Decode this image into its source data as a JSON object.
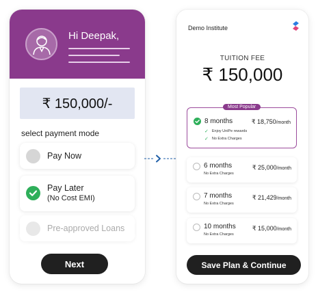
{
  "left_screen": {
    "greeting": "Hi Deepak,",
    "amount": "₹ 150,000/-",
    "payment_mode_label": "select payment mode",
    "options": [
      {
        "label": "Pay Now",
        "sub": "",
        "state": "unselected"
      },
      {
        "label": "Pay Later",
        "sub": "(No Cost EMI)",
        "state": "selected"
      },
      {
        "label": "Pre-approved Loans",
        "sub": "",
        "state": "disabled"
      }
    ],
    "next_label": "Next"
  },
  "right_screen": {
    "institute": "Demo Institute",
    "fee_label": "TUITION FEE",
    "fee_amount": "₹ 150,000",
    "plans": [
      {
        "badge": "Most Popular",
        "months": "8 months",
        "price": "₹ 18,750",
        "per": "/month",
        "benefits": [
          "Enjoy UniPe rewards",
          "No Extra Charges"
        ],
        "selected": true
      },
      {
        "months": "6 months",
        "extra": "No Extra Charges",
        "price": "₹ 25,000",
        "per": "/month",
        "selected": false
      },
      {
        "months": "7 months",
        "extra": "No Extra Charges",
        "price": "₹ 21,429",
        "per": "/month",
        "selected": false
      },
      {
        "months": "10 months",
        "extra": "No Extra Charges",
        "price": "₹ 15,000",
        "per": "/month",
        "selected": false
      }
    ],
    "save_label": "Save Plan & Continue"
  },
  "colors": {
    "purple": "#8a3a8c",
    "green": "#2eaf5a",
    "dark_button": "#202020",
    "amount_box": "#e2e6f2",
    "connector": "#1f5fa8"
  },
  "icons": {
    "avatar": "user-avatar-icon",
    "check": "check-circle-icon",
    "brand": "brand-logo-icon",
    "arrow": "arrow-right-icon"
  }
}
